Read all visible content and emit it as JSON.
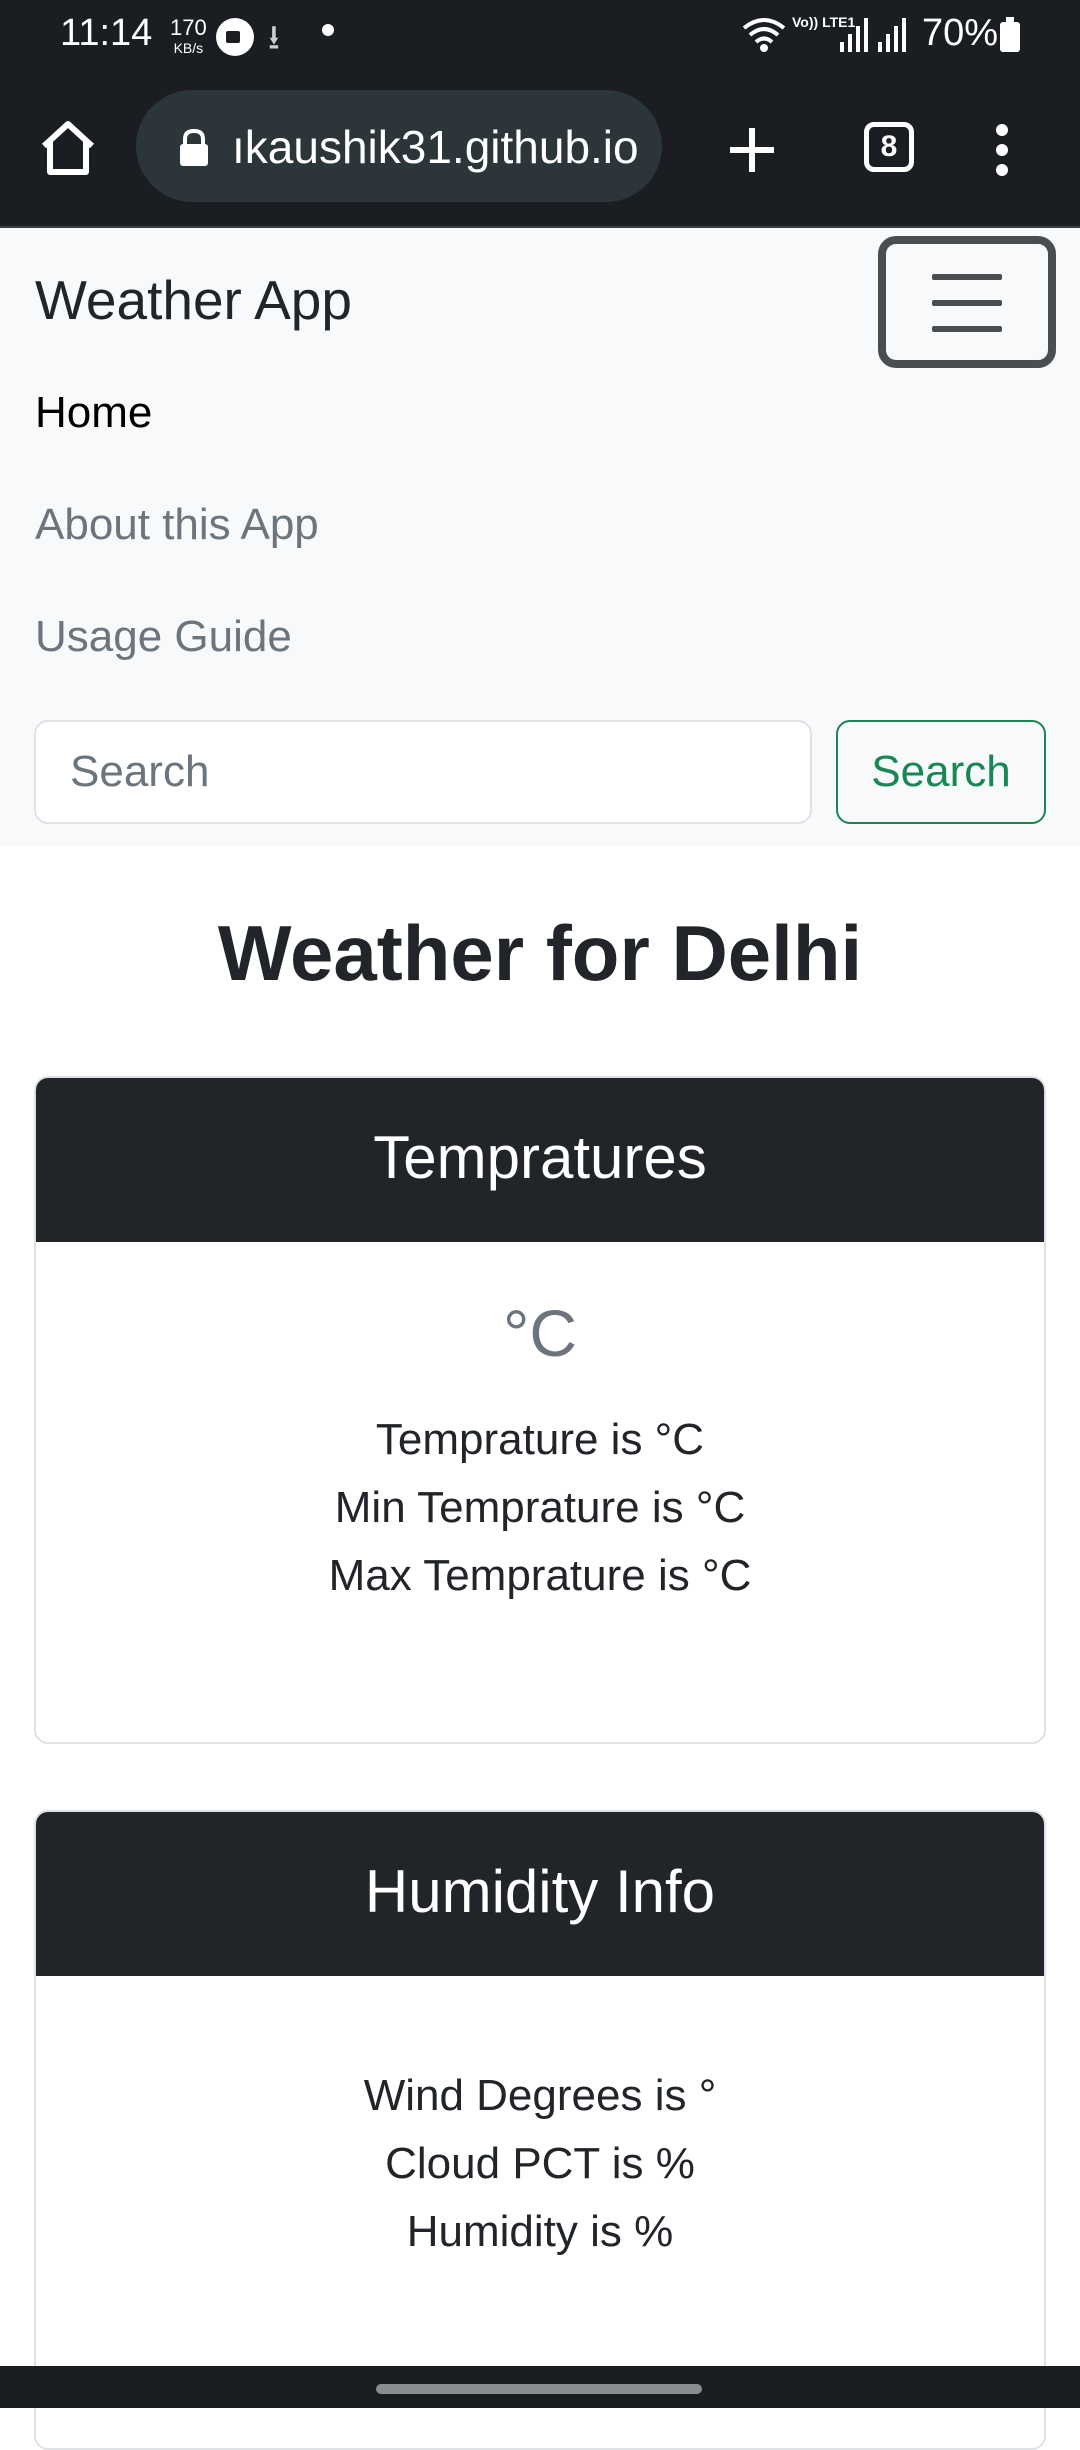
{
  "status_bar": {
    "time": "11:14",
    "net_speed": "170",
    "net_speed_unit": "KB/s",
    "volte_label": "Vo)) LTE1",
    "battery": "70%"
  },
  "browser": {
    "url": "ıkaushik31.github.io",
    "tab_count": "8"
  },
  "navbar": {
    "brand": "Weather App",
    "links": [
      {
        "label": "Home"
      },
      {
        "label": "About this App"
      },
      {
        "label": "Usage Guide"
      }
    ],
    "search": {
      "placeholder": "Search",
      "button_label": "Search"
    }
  },
  "main": {
    "title": "Weather for Delhi",
    "cards": [
      {
        "header": "Tempratures",
        "value": "°C",
        "lines": [
          "Temprature is °C",
          "Min Temprature is °C",
          "Max Temprature is °C"
        ]
      },
      {
        "header": "Humidity Info",
        "lines": [
          "Wind Degrees is °",
          "Cloud PCT is %",
          "Humidity is %"
        ]
      }
    ]
  },
  "colors": {
    "status_bg": "#1a1e22",
    "url_pill": "#2c353a",
    "navbar_bg": "#f8f9fa",
    "card_header": "#212529",
    "success": "#198754",
    "muted": "#6c757d"
  }
}
